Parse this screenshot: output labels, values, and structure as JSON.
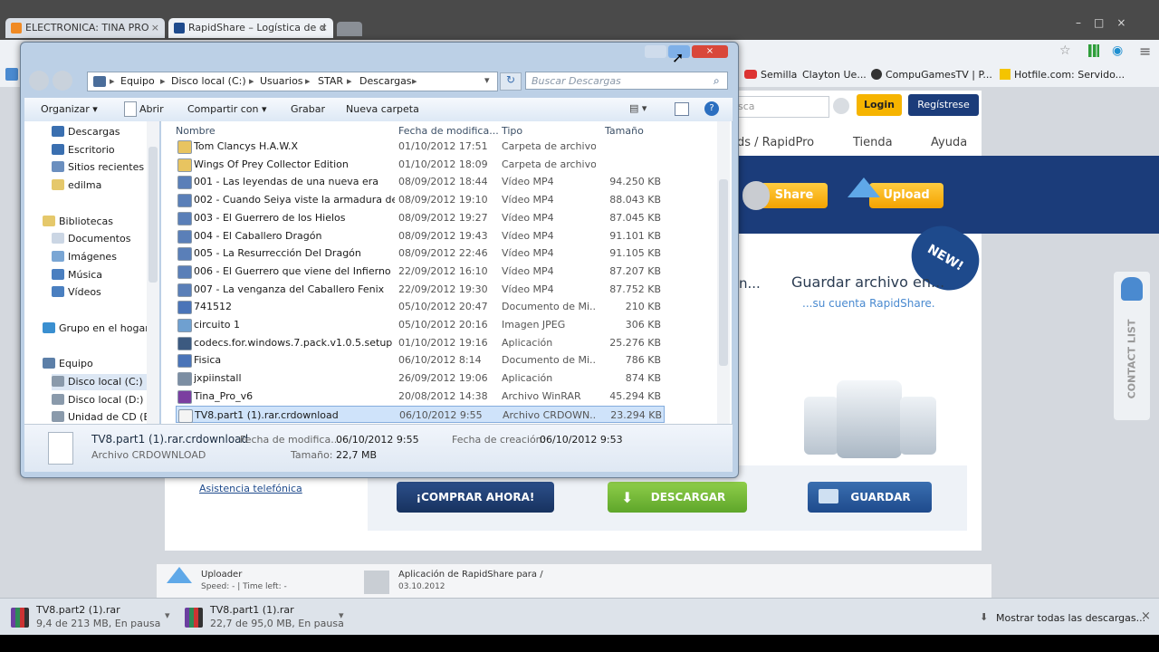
{
  "browser": {
    "tabs": [
      {
        "title": "ELECTRONICA: TINA PRO",
        "color": "#f08a24"
      },
      {
        "title": "RapidShare – Logística de d",
        "color": "#1e4a8c"
      }
    ],
    "bookmarks": [
      "Semilla",
      "Clayton Ue...",
      "CompuGamesTV | P...",
      "Hotfile.com: Servido..."
    ]
  },
  "site": {
    "search_placeholder": "sca",
    "login": "Login",
    "register": "Regístrese",
    "nav": [
      "ds / RapidPro",
      "Tienda",
      "Ayuda"
    ],
    "share": "Share",
    "upload": "Upload",
    "badge": "NEW!",
    "promo_title": "Guardar archivo en...",
    "promo_sub": "...su cuenta RapidShare.",
    "left_partial": "n...",
    "link": "Asistencia telefónica",
    "buy": "¡COMPRAR AHORA!",
    "download": "DESCARGAR",
    "save": "GUARDAR",
    "contact": "CONTACT LIST",
    "uploader_title": "Uploader",
    "uploader_stat": "Speed: - | Time left: -",
    "app_title": "Aplicación de RapidShare para /",
    "app_date": "03.10.2012"
  },
  "downloads": {
    "items": [
      {
        "name": "TV8.part2 (1).rar",
        "status": "9,4 de 213 MB, En pausa"
      },
      {
        "name": "TV8.part1 (1).rar",
        "status": "22,7 de 95,0 MB, En pausa"
      }
    ],
    "show_all": "Mostrar todas las descargas..."
  },
  "explorer": {
    "breadcrumb": [
      "Equipo",
      "Disco local (C:)",
      "Usuarios",
      "STAR",
      "Descargas"
    ],
    "search_placeholder": "Buscar Descargas",
    "toolbar": {
      "organize": "Organizar",
      "open": "Abrir",
      "share": "Compartir con",
      "burn": "Grabar",
      "new_folder": "Nueva carpeta"
    },
    "nav": [
      {
        "label": "Descargas",
        "color": "#3a6fb0",
        "indent": 1
      },
      {
        "label": "Escritorio",
        "color": "#3a6fb0",
        "indent": 1
      },
      {
        "label": "Sitios recientes",
        "color": "#6b8fbf",
        "indent": 1
      },
      {
        "label": "edilma",
        "color": "#e5c86b",
        "indent": 1
      },
      {
        "label": "",
        "color": "",
        "indent": 0
      },
      {
        "label": "Bibliotecas",
        "color": "#e5c86b",
        "indent": 0
      },
      {
        "label": "Documentos",
        "color": "#cbd6e4",
        "indent": 1
      },
      {
        "label": "Imágenes",
        "color": "#7aa6d4",
        "indent": 1
      },
      {
        "label": "Música",
        "color": "#4a7fc0",
        "indent": 1
      },
      {
        "label": "Vídeos",
        "color": "#4a7fc0",
        "indent": 1
      },
      {
        "label": "",
        "color": "",
        "indent": 0
      },
      {
        "label": "Grupo en el hogar",
        "color": "#3a8fd0",
        "indent": 0
      },
      {
        "label": "",
        "color": "",
        "indent": 0
      },
      {
        "label": "Equipo",
        "color": "#5c7fa8",
        "indent": 0
      },
      {
        "label": "Disco local (C:)",
        "color": "#8a9aab",
        "indent": 1
      },
      {
        "label": "Disco local (D:)",
        "color": "#8a9aab",
        "indent": 1
      },
      {
        "label": "Unidad de CD (E:)",
        "color": "#8a9aab",
        "indent": 1
      }
    ],
    "columns": [
      "Nombre",
      "Fecha de modifica...",
      "Tipo",
      "Tamaño"
    ],
    "files": [
      {
        "name": "Tom Clancys H.A.W.X",
        "date": "01/10/2012 17:51",
        "type": "Carpeta de archivos",
        "size": "",
        "icon": "#e8c460"
      },
      {
        "name": "Wings Of Prey Collector Edition",
        "date": "01/10/2012 18:09",
        "type": "Carpeta de archivos",
        "size": "",
        "icon": "#e8c460"
      },
      {
        "name": "001 - Las leyendas de una nueva era",
        "date": "08/09/2012 18:44",
        "type": "Vídeo MP4",
        "size": "94.250 KB",
        "icon": "#5a7fb8"
      },
      {
        "name": "002 - Cuando Seiya viste la armadura de ...",
        "date": "08/09/2012 19:10",
        "type": "Vídeo MP4",
        "size": "88.043 KB",
        "icon": "#5a7fb8"
      },
      {
        "name": "003 - El Guerrero de los Hielos",
        "date": "08/09/2012 19:27",
        "type": "Vídeo MP4",
        "size": "87.045 KB",
        "icon": "#5a7fb8"
      },
      {
        "name": "004 - El Caballero Dragón",
        "date": "08/09/2012 19:43",
        "type": "Vídeo MP4",
        "size": "91.101 KB",
        "icon": "#5a7fb8"
      },
      {
        "name": "005 - La Resurrección Del Dragón",
        "date": "08/09/2012 22:46",
        "type": "Vídeo MP4",
        "size": "91.105 KB",
        "icon": "#5a7fb8"
      },
      {
        "name": "006 - El Guerrero que viene del Infierno",
        "date": "22/09/2012 16:10",
        "type": "Vídeo MP4",
        "size": "87.207 KB",
        "icon": "#5a7fb8"
      },
      {
        "name": "007 - La venganza del Caballero Fenix",
        "date": "22/09/2012 19:30",
        "type": "Vídeo MP4",
        "size": "87.752 KB",
        "icon": "#5a7fb8"
      },
      {
        "name": "741512",
        "date": "05/10/2012 20:47",
        "type": "Documento de Mi...",
        "size": "210 KB",
        "icon": "#4a74b8"
      },
      {
        "name": "circuito 1",
        "date": "05/10/2012 20:16",
        "type": "Imagen JPEG",
        "size": "306 KB",
        "icon": "#6fa0d0"
      },
      {
        "name": "codecs.for.windows.7.pack.v1.0.5.setup",
        "date": "01/10/2012 19:16",
        "type": "Aplicación",
        "size": "25.276 KB",
        "icon": "#3c5a80"
      },
      {
        "name": "Fisica",
        "date": "06/10/2012 8:14",
        "type": "Documento de Mi...",
        "size": "786 KB",
        "icon": "#4a74b8"
      },
      {
        "name": "jxpiinstall",
        "date": "26/09/2012 19:06",
        "type": "Aplicación",
        "size": "874 KB",
        "icon": "#7c8ea3"
      },
      {
        "name": "Tina_Pro_v6",
        "date": "20/08/2012 14:38",
        "type": "Archivo WinRAR",
        "size": "45.294 KB",
        "icon": "#7b3fa0"
      },
      {
        "name": "TV8.part1 (1).rar.crdownload",
        "date": "06/10/2012 9:55",
        "type": "Archivo CRDOWN...",
        "size": "23.294 KB",
        "icon": "#f4f4f4"
      }
    ],
    "status": {
      "file": "TV8.part1 (1).rar.crdownload",
      "type": "Archivo CRDOWNLOAD",
      "mod_label": "Fecha de modifica...",
      "mod_value": "06/10/2012 9:55",
      "size_label": "Tamaño:",
      "size_value": "22,7 MB",
      "created_label": "Fecha de creación:",
      "created_value": "06/10/2012 9:53"
    }
  }
}
